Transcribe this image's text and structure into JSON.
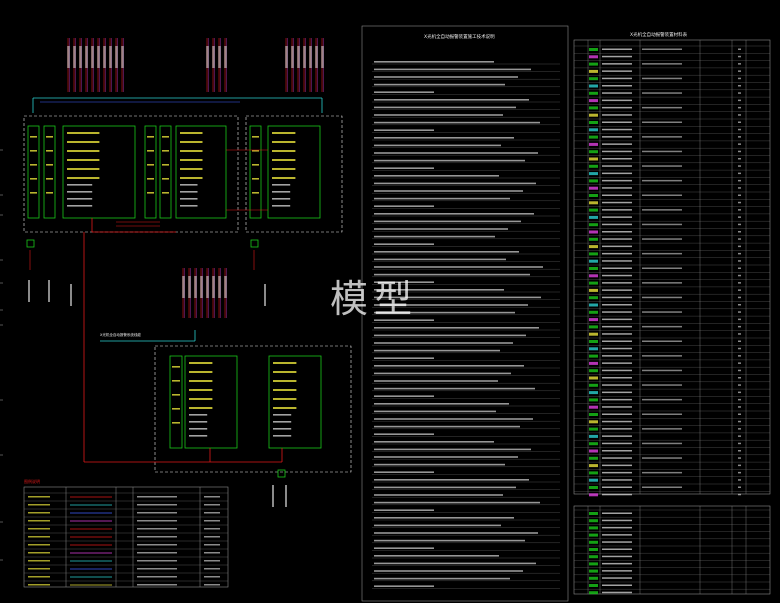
{
  "colors": {
    "background": "#000000",
    "green": "#19c819",
    "yellow": "#e8e23a",
    "red": "#e01818",
    "magenta": "#e040e0",
    "cyan": "#2ad0d0",
    "blue": "#4060ff",
    "white": "#e8e8e8",
    "gray": "#8c8c8c"
  },
  "watermark": "模型",
  "notes_title": "X光机全自动报警装置施工技术说明",
  "equipment_table_title": "X光机全自动报警装置材料表",
  "equipment_table_headers": [
    "序号",
    "图例",
    "名称",
    "型号规格",
    "单位",
    "数量",
    "备注"
  ],
  "equipment_subtable_headers": [
    "序号",
    "图例",
    "名称",
    "型号规格",
    "单位",
    "数量",
    "备注"
  ],
  "legend_title": "图例说明",
  "legend_headers": [
    "名称",
    "图例",
    "代号",
    "型号规格",
    "敷设方式"
  ],
  "cable_label": "X光机全自动报警系统线缆"
}
